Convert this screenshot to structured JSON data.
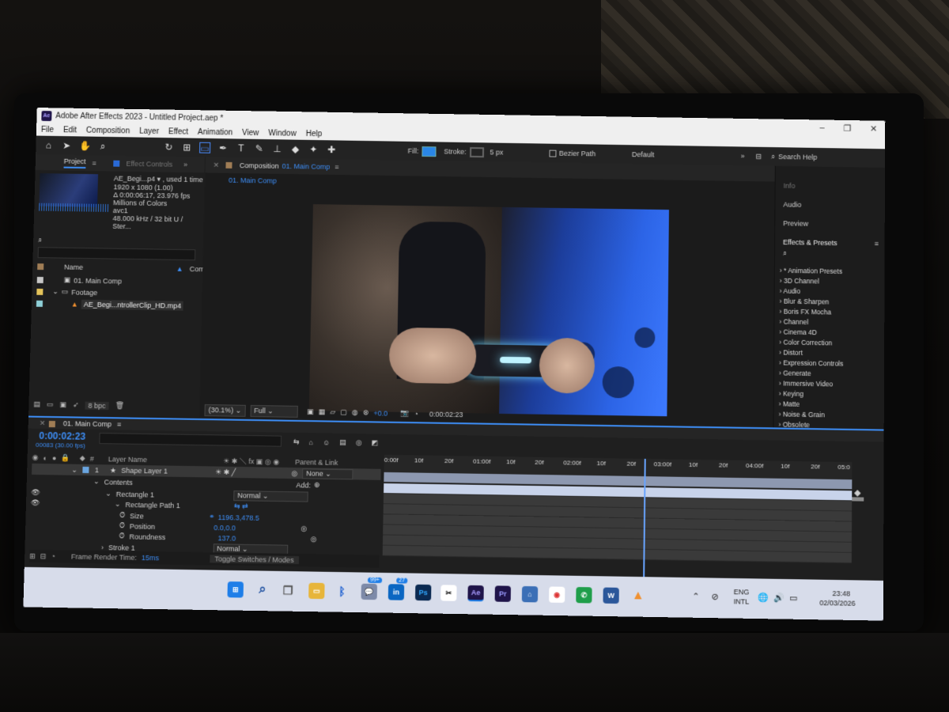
{
  "window": {
    "title": "Adobe After Effects 2023 - Untitled Project.aep *",
    "badge": "Ae"
  },
  "menu": [
    "File",
    "Edit",
    "Composition",
    "Layer",
    "Effect",
    "Animation",
    "View",
    "Window",
    "Help"
  ],
  "toolbar": {
    "fill_label": "Fill:",
    "stroke_label": "Stroke:",
    "stroke_width": "5 px",
    "bezier_label": "Bezier Path",
    "default_label": "Default",
    "search_label": "Search Help",
    "fill_color": "#2a86e6"
  },
  "project": {
    "tab": "Project",
    "tab2": "Effect Controls",
    "item_name": "AE_Begi...p4 ▾ , used 1 time",
    "info_lines": [
      "1920 x 1080 (1.00)",
      "Δ 0:00:06:17, 23.976 fps",
      "Millions of Colors",
      "avc1",
      "48.000 kHz / 32 bit U / Ster..."
    ],
    "col_name": "Name",
    "col_comment": "Comm",
    "items": [
      "01. Main Comp",
      "Footage",
      "AE_Begi...ntrollerClip_HD.mp4"
    ],
    "bpc": "8 bpc"
  },
  "composition": {
    "tab_prefix": "Composition",
    "tab_name": "01. Main Comp",
    "breadcrumb": "01. Main Comp",
    "zoom": "(30.1%)",
    "resolution": "Full",
    "exposure": "+0.0",
    "timecode": "0:00:02:23"
  },
  "right_panel": {
    "items": [
      "Info",
      "Audio",
      "Preview",
      "Effects & Presets"
    ],
    "effects": [
      "* Animation Presets",
      "3D Channel",
      "Audio",
      "Blur & Sharpen",
      "Boris FX Mocha",
      "Channel",
      "Cinema 4D",
      "Color Correction",
      "Distort",
      "Expression Controls",
      "Generate",
      "Immersive Video",
      "Keying",
      "Matte",
      "Noise & Grain",
      "Obsolete"
    ]
  },
  "timeline": {
    "tab": "01. Main Comp",
    "timecode": "0:00:02:23",
    "frames": "00083 (30.00 fps)",
    "col_layer": "Layer Name",
    "col_parent": "Parent & Link",
    "ticks": [
      "0:00f",
      "10f",
      "20f",
      "01:00f",
      "10f",
      "20f",
      "02:00f",
      "10f",
      "20f",
      "03:00f",
      "10f",
      "20f",
      "04:00f",
      "10f",
      "20f",
      "05:0"
    ],
    "layer_num": "1",
    "layer_name": "Shape Layer 1",
    "parent": "None",
    "contents": "Contents",
    "add": "Add:",
    "rect1": "Rectangle 1",
    "rect1_mode": "Normal",
    "rect_path": "Rectangle Path 1",
    "size_label": "Size",
    "size_value": "1196.3,478.5",
    "pos_label": "Position",
    "pos_value": "0.0,0.0",
    "round_label": "Roundness",
    "round_value": "137.0",
    "stroke_label": "Stroke 1",
    "stroke_mode": "Normal",
    "render_label": "Frame Render Time:",
    "render_value": "15ms",
    "toggle": "Toggle Switches / Modes"
  },
  "taskbar": {
    "badge_chat": "99+",
    "badge_in": "27",
    "lang1": "ENG",
    "lang2": "INTL",
    "time": "23:48",
    "date": "02/03/2026"
  }
}
